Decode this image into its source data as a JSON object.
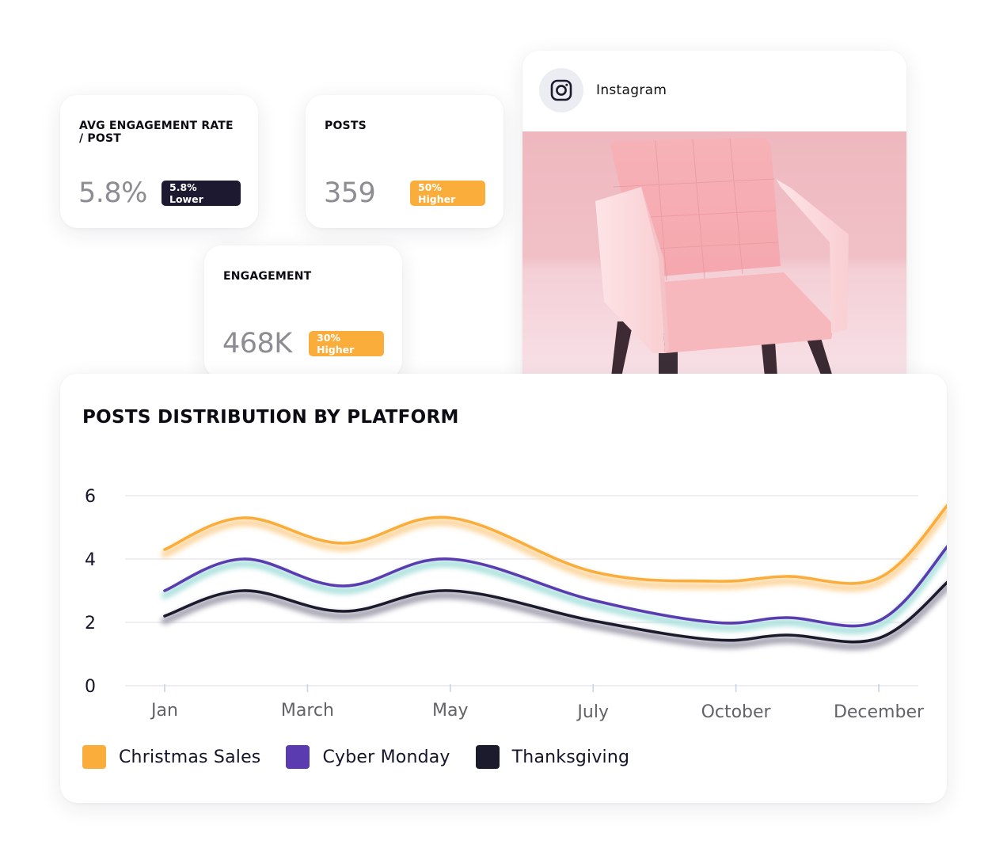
{
  "stats": [
    {
      "title": "AVG ENGAGEMENT RATE / POST",
      "value": "5.8%",
      "badge": "5.8% Lower",
      "badge_color": "#1c1930"
    },
    {
      "title": "POSTS",
      "value": "359",
      "badge": "50% Higher",
      "badge_color": "#fbad3b"
    },
    {
      "title": "ENGAGEMENT",
      "value": "468K",
      "badge": "30% Higher",
      "badge_color": "#fbad3b"
    }
  ],
  "instagram_card": {
    "platform": "Instagram",
    "icon": "instagram-icon",
    "image": "pink-armchair-photo"
  },
  "chart_data": {
    "type": "line",
    "title": "POSTS DISTRIBUTION BY PLATFORM",
    "xlabel": "",
    "ylabel": "",
    "x_ticks": [
      "Jan",
      "March",
      "May",
      "July",
      "October",
      "December"
    ],
    "y_ticks": [
      "0",
      "2",
      "4",
      "6"
    ],
    "ylim": [
      0,
      6
    ],
    "grid": true,
    "legend_position": "bottom-left",
    "x": [
      0,
      0.55,
      1.25,
      2,
      3,
      3.85,
      4.35,
      5,
      5.5
    ],
    "x_tick_positions": [
      0,
      1,
      2,
      3,
      4,
      5
    ],
    "series": [
      {
        "name": "Christmas Sales",
        "color": "#fbad3b",
        "glow": "#fcd49a",
        "values": [
          4.3,
          5.3,
          4.5,
          5.3,
          3.6,
          3.3,
          3.45,
          3.4,
          5.8
        ]
      },
      {
        "name": "Cyber Monday",
        "color": "#5b3bb0",
        "glow": "#a8e0dc",
        "values": [
          3.0,
          4.0,
          3.15,
          4.0,
          2.7,
          2.0,
          2.15,
          2.05,
          4.5
        ]
      },
      {
        "name": "Thanksgiving",
        "color": "#1c1b2e",
        "glow": "#a09fae",
        "values": [
          2.2,
          3.0,
          2.35,
          3.0,
          2.05,
          1.45,
          1.6,
          1.5,
          3.35
        ]
      }
    ]
  }
}
